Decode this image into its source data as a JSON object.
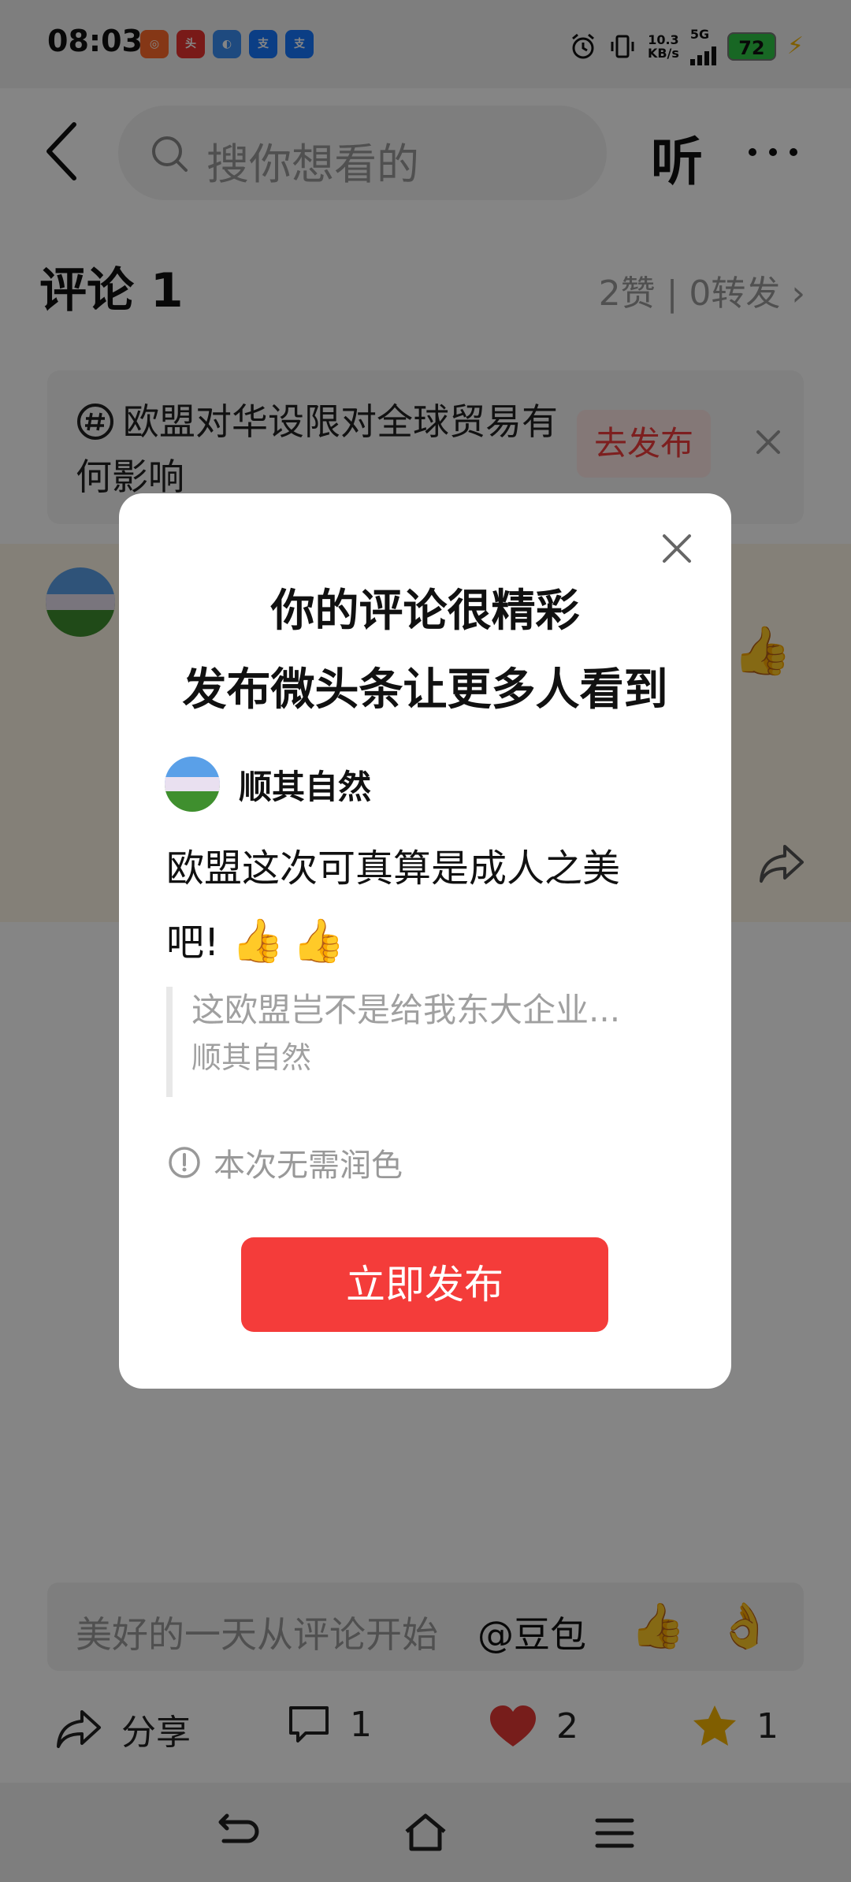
{
  "status_bar": {
    "time": "08:03",
    "app_icons": [
      "aoyo",
      "头条",
      "note",
      "支",
      "支"
    ],
    "net_speed_value": "10.3",
    "net_speed_unit": "KB/s",
    "network": "5G",
    "battery": "72"
  },
  "header": {
    "search_placeholder": "搜你想看的",
    "listen_label": "听"
  },
  "comments": {
    "title": "评论 1",
    "stats": "2赞 | 0转发"
  },
  "topic": {
    "text": "欧盟对华设限对全球贸易有何影响",
    "publish_label": "去发布"
  },
  "input_bar": {
    "placeholder": "美好的一天从评论开始",
    "mention": "@豆包",
    "emoji_1": "👍",
    "emoji_2": "👌"
  },
  "action_bar": {
    "share_label": "分享",
    "comment_count": "1",
    "like_count": "2",
    "favorite_count": "1"
  },
  "modal": {
    "title_line1": "你的评论很精彩",
    "title_line2": "发布微头条让更多人看到",
    "author_name": "顺其自然",
    "comment_text": "欧盟这次可真算是成人之美吧!",
    "comment_emojis": "👍👍",
    "quote_text": "这欧盟岂不是给我东大企业...",
    "quote_author": "顺其自然",
    "notice": "本次无需润色",
    "publish_button": "立即发布"
  },
  "colors": {
    "accent_red": "#f43c3a",
    "like_red": "#e53935",
    "star_gold": "#f5b400"
  }
}
